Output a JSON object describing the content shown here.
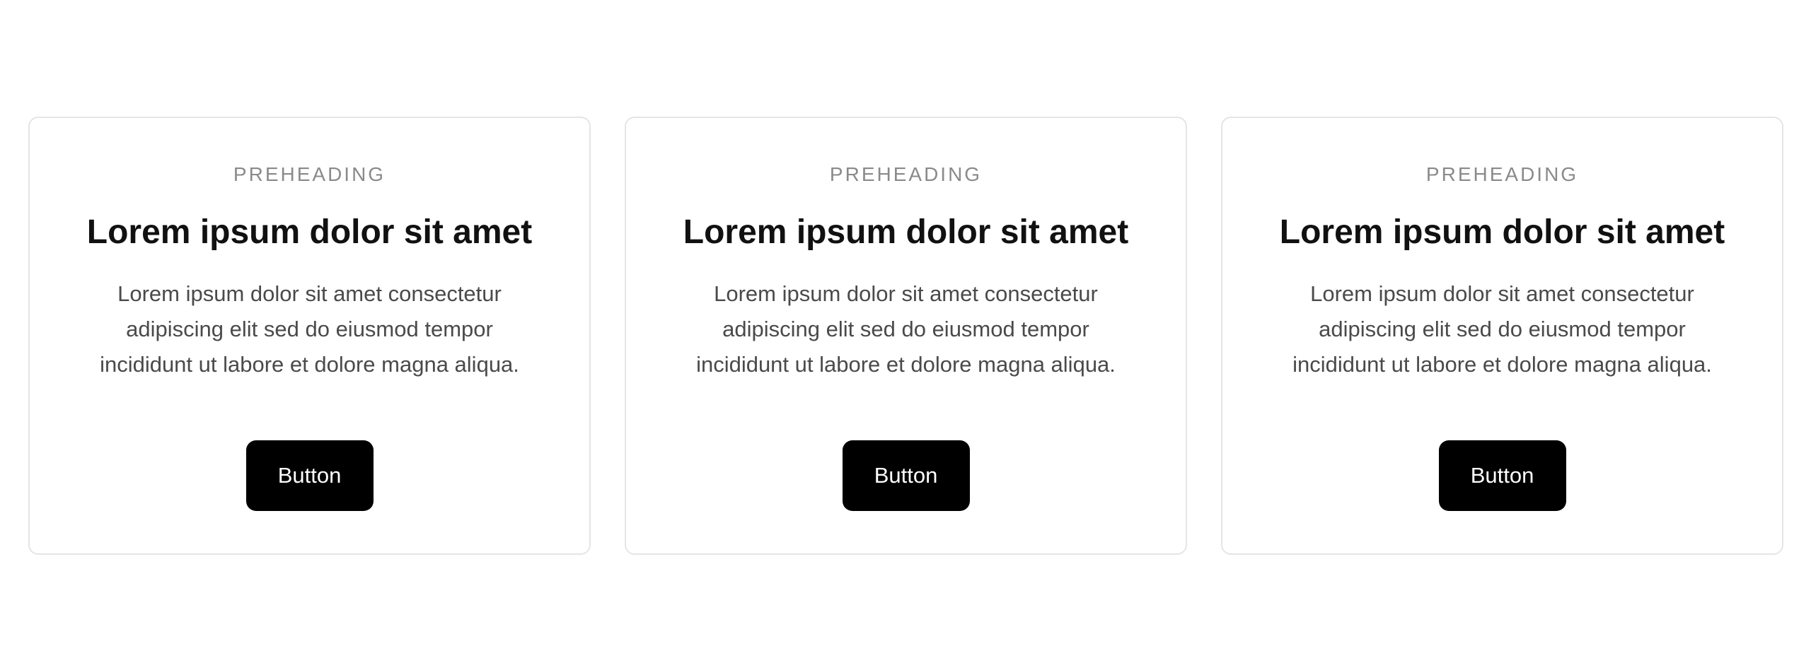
{
  "cards": [
    {
      "preheading": "PREHEADING",
      "title": "Lorem ipsum dolor sit amet",
      "body": "Lorem ipsum dolor sit amet consectetur adipiscing elit sed do eiusmod tempor incididunt ut labore et dolore magna aliqua.",
      "button_label": "Button"
    },
    {
      "preheading": "PREHEADING",
      "title": "Lorem ipsum dolor sit amet",
      "body": "Lorem ipsum dolor sit amet consectetur adipiscing elit sed do eiusmod tempor incididunt ut labore et dolore magna aliqua.",
      "button_label": "Button"
    },
    {
      "preheading": "PREHEADING",
      "title": "Lorem ipsum dolor sit amet",
      "body": "Lorem ipsum dolor sit amet consectetur adipiscing elit sed do eiusmod tempor incididunt ut labore et dolore magna aliqua.",
      "button_label": "Button"
    }
  ],
  "colors": {
    "button_background": "#000000",
    "button_text": "#ffffff",
    "preheading_text": "#8a8a8a",
    "card_border": "#e5e5e5"
  }
}
